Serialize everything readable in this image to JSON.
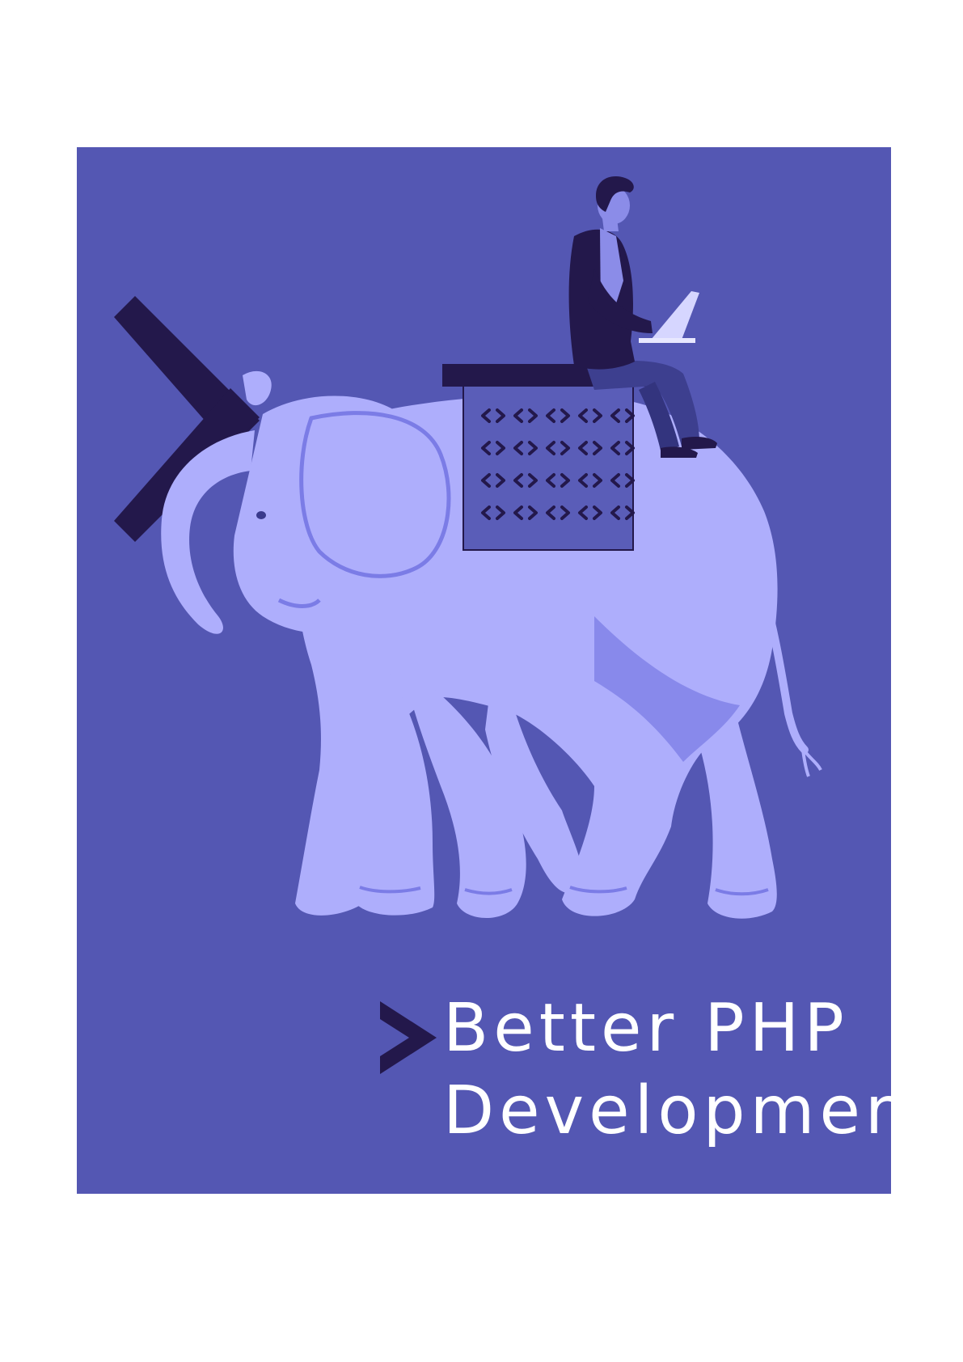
{
  "cover": {
    "title_line_1": "Better PHP",
    "title_line_2": "Development"
  },
  "illustration": {
    "subject": "person with laptop riding an elephant",
    "icons": [
      "elephant-illustration",
      "developer-figure",
      "laptop-icon",
      "chevron-icon",
      "code-pattern-saddle"
    ]
  },
  "colors": {
    "background": "#5457b3",
    "elephant": "#aeaefc",
    "elephant_shadow": "#7b7ce6",
    "dark_accent": "#23184b",
    "title_text": "#ffffff",
    "page": "#ffffff"
  }
}
